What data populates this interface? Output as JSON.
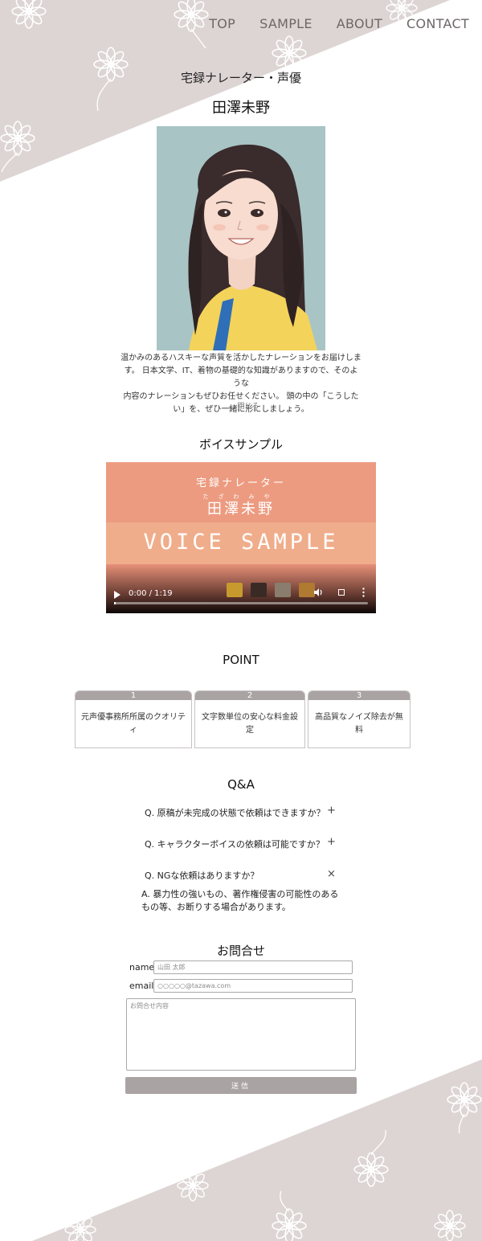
{
  "colors": {
    "background_band": "#ddd5d4",
    "flower": "#ffffff",
    "nav_text": "#6d6768",
    "card_header": "#aaa3a4",
    "video_top": "#ec9b80",
    "video_mid": "#f0ad8b",
    "portrait_bg": "#a8c4c5"
  },
  "nav": {
    "items": [
      {
        "label": "TOP"
      },
      {
        "label": "SAMPLE"
      },
      {
        "label": "ABOUT"
      },
      {
        "label": "CONTACT"
      }
    ]
  },
  "hero": {
    "subtitle": "宅録ナレーター・声優",
    "name": "田澤未野",
    "bio_line1": "温かみのあるハスキーな声質を活かしたナレーションをお届けしま",
    "bio_line2": "す。 日本文学、IT、着物の基礎的な知識がありますので、そのような",
    "bio_line3": "内容のナレーションもぜひお任せください。 頭の中の「こうした",
    "bio_line4": "い」を、ぜひ一緒に形にしましょう。",
    "close_link": "……閉じる"
  },
  "voice": {
    "title": "ボイスサンプル",
    "video_subtitle": "宅録ナレーター",
    "video_ruby": "たざわみや",
    "video_name": "田澤未野",
    "video_title": "VOICE SAMPLE",
    "time": "0:00 / 1:19",
    "progress": 0.0,
    "icons": [
      "play-icon",
      "volume-icon",
      "fullscreen-icon",
      "more-options-icon"
    ]
  },
  "point": {
    "title": "POINT",
    "cards": [
      {
        "num": "1",
        "text": "元声優事務所所属のクオリティ"
      },
      {
        "num": "2",
        "text": "文字数単位の安心な料金設定"
      },
      {
        "num": "3",
        "text": "高品質なノイズ除去が無料"
      }
    ]
  },
  "qa": {
    "title": "Q&A",
    "items": [
      {
        "question": "Q. 原稿が未完成の状態で依頼はできますか？",
        "toggle": "+"
      },
      {
        "question": "Q. キャラクターボイスの依頼は可能ですか？",
        "toggle": "+"
      },
      {
        "question": "Q. NGな依頼はありますか？",
        "toggle": "×"
      }
    ],
    "answer": "A. 暴力性の強いもの、著作権侵害の可能性のあるもの等、お断りする場合があります。"
  },
  "contact": {
    "title": "お問合せ",
    "name_label": "name",
    "name_placeholder": "山田 太郎",
    "email_label": "email",
    "email_placeholder": "○○○○○@tazawa.com",
    "message_placeholder": "お問合せ内容",
    "submit_label": "送信"
  }
}
